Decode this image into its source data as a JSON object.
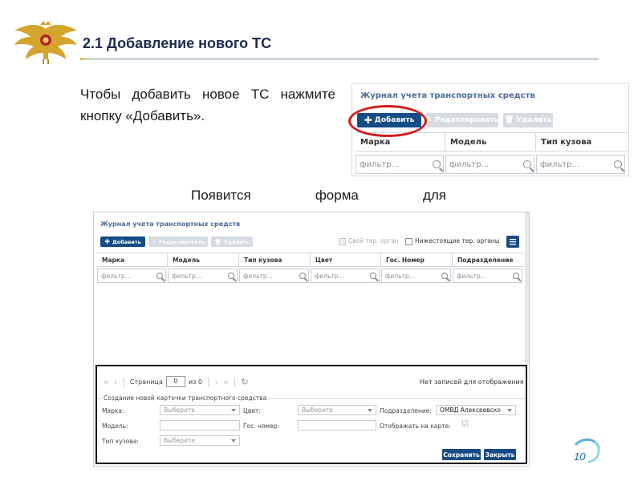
{
  "slide": {
    "title": "2.1 Добавление нового ТС",
    "instruction": "Чтобы добавить новое ТС нажмите кнопку «Добавить».",
    "appear_words": [
      "Появится",
      "форма",
      "для"
    ],
    "page_number": "10"
  },
  "top_panel": {
    "title": "Журнал учета транспортных средств",
    "toolbar": {
      "add_label": "Добавить",
      "edit_label": "Редактировать",
      "delete_label": "Удалить"
    },
    "columns": [
      "Марка",
      "Модель",
      "Тип кузова"
    ],
    "filter_placeholder": "фильтр..."
  },
  "grid": {
    "title": "Журнал учета транспортных средств",
    "toolbar": {
      "add_label": "Добавить",
      "edit_label": "Редактировать",
      "delete_label": "Удалить",
      "own_org_label": "Свой тер. орган",
      "sub_org_label": "Нижестоящие тер. органы"
    },
    "columns": [
      "Марка",
      "Модель",
      "Тип кузова",
      "Цвет",
      "Гос. Номер",
      "Подразделение"
    ],
    "filter_placeholder": "фильтр...",
    "pager": {
      "page_label": "Страница",
      "page_value": "0",
      "of_label": "из 0",
      "empty_message": "Нет записей для отображения"
    }
  },
  "form": {
    "title": "Создание новой карточки транспортного средства",
    "brand_label": "Марка:",
    "brand_value": "Выберите",
    "model_label": "Модель:",
    "body_type_label": "Тип кузова:",
    "body_type_value": "Выберите",
    "color_label": "Цвет:",
    "color_value": "Выберите",
    "plate_label": "Гос. номер:",
    "division_label": "Подразделение:",
    "division_value": "ОМВД Алексеевско",
    "show_on_map_label": "Отображать на карте:",
    "save_label": "Сохранить",
    "close_label": "Закрыть"
  },
  "colors": {
    "primary_button": "#164c86",
    "highlight_ring": "#d41c1c",
    "title_text": "#1d2b50"
  }
}
